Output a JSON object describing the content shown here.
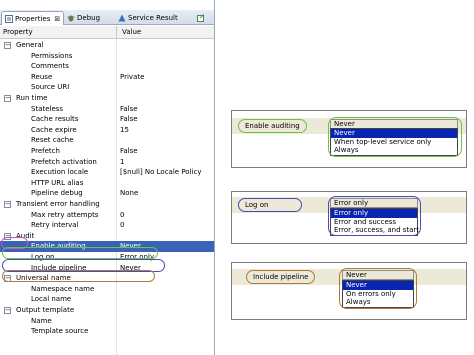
{
  "tabs": [
    {
      "label": "Properties",
      "close": "⊠",
      "icon": "properties-icon"
    },
    {
      "label": "Debug",
      "icon": "debug-icon"
    },
    {
      "label": "Service Result",
      "icon": "service-result-icon"
    },
    {
      "label": "",
      "icon": "export-icon"
    }
  ],
  "columns": {
    "property": "Property",
    "value": "Value"
  },
  "rows": [
    {
      "type": "cat",
      "expander": "⊟",
      "name": "General",
      "value": ""
    },
    {
      "type": "prop",
      "name": "Permissions",
      "value": ""
    },
    {
      "type": "prop",
      "name": "Comments",
      "value": ""
    },
    {
      "type": "prop",
      "name": "Reuse",
      "value": "Private"
    },
    {
      "type": "prop",
      "name": "Source URI",
      "value": ""
    },
    {
      "type": "cat",
      "expander": "⊟",
      "name": "Run time",
      "value": ""
    },
    {
      "type": "prop",
      "name": "Stateless",
      "value": "False"
    },
    {
      "type": "prop",
      "name": "Cache results",
      "value": "False"
    },
    {
      "type": "prop",
      "name": "Cache expire",
      "value": "15"
    },
    {
      "type": "prop",
      "name": "Reset cache",
      "value": ""
    },
    {
      "type": "prop",
      "name": "Prefetch",
      "value": "False"
    },
    {
      "type": "prop",
      "name": "Prefetch activation",
      "value": "1"
    },
    {
      "type": "prop",
      "name": "Execution locale",
      "value": "[$null] No Locale Policy"
    },
    {
      "type": "prop",
      "name": "HTTP URL alias",
      "value": ""
    },
    {
      "type": "prop",
      "name": "Pipeline debug",
      "value": "None"
    },
    {
      "type": "cat",
      "expander": "⊟",
      "name": "Transient error handling",
      "value": ""
    },
    {
      "type": "prop",
      "name": "Max retry attempts",
      "value": "0"
    },
    {
      "type": "prop",
      "name": "Retry interval",
      "value": "0"
    },
    {
      "type": "cat",
      "expander": "⊟",
      "name": "Audit",
      "value": ""
    },
    {
      "type": "prop",
      "name": "Enable auditing",
      "value": "Never",
      "selected": true
    },
    {
      "type": "prop",
      "name": "Log on",
      "value": "Error only"
    },
    {
      "type": "prop",
      "name": "Include pipeline",
      "value": "Never"
    },
    {
      "type": "cat",
      "expander": "⊟",
      "name": "Universal name",
      "value": ""
    },
    {
      "type": "prop",
      "name": "Namespace name",
      "value": ""
    },
    {
      "type": "prop",
      "name": "Local name",
      "value": ""
    },
    {
      "type": "cat",
      "expander": "⊟",
      "name": "Output template",
      "value": ""
    },
    {
      "type": "prop",
      "name": "Name",
      "value": ""
    },
    {
      "type": "prop",
      "name": "Template source",
      "value": ""
    }
  ],
  "examples": {
    "auditing": {
      "label": "Enable auditing",
      "selected": "Never",
      "options": [
        "Never",
        "When top-level service only",
        "Always"
      ],
      "highlight": 0,
      "color": "#6cc24a"
    },
    "logon": {
      "label": "Log on",
      "selected": "Error only",
      "options": [
        "Error only",
        "Error and success",
        "Error, success, and start"
      ],
      "highlight": 0,
      "color": "#4a4ab8"
    },
    "pipeline": {
      "label": "Include pipeline",
      "selected": "Never",
      "options": [
        "Never",
        "On errors only",
        "Always"
      ],
      "highlight": 0,
      "color": "#b07a3a"
    }
  },
  "colors": {
    "selection": "#3a62b5",
    "list_highlight": "#0a24b4",
    "audit_oval": "#d050c0"
  }
}
